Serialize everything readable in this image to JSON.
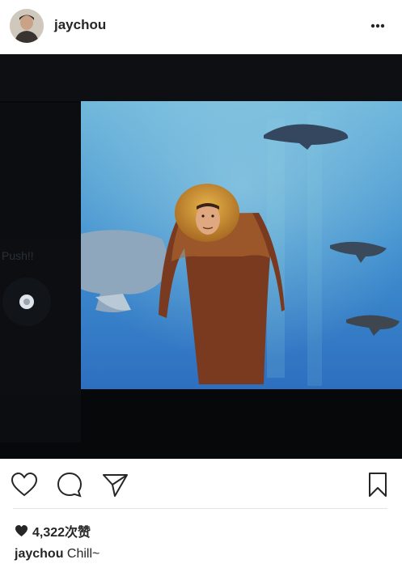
{
  "post": {
    "username": "jaychou",
    "more_icon": "more-horizontal-icon",
    "photo_alt": "",
    "screen_text": "Push!!"
  },
  "actions": {
    "like_icon": "heart-outline-icon",
    "comment_icon": "comment-bubble-icon",
    "share_icon": "paper-plane-icon",
    "save_icon": "bookmark-icon"
  },
  "likes": {
    "icon": "heart-filled-icon",
    "text": "4,322次赞"
  },
  "caption": {
    "username": "jaychou",
    "text": "Chill~"
  }
}
